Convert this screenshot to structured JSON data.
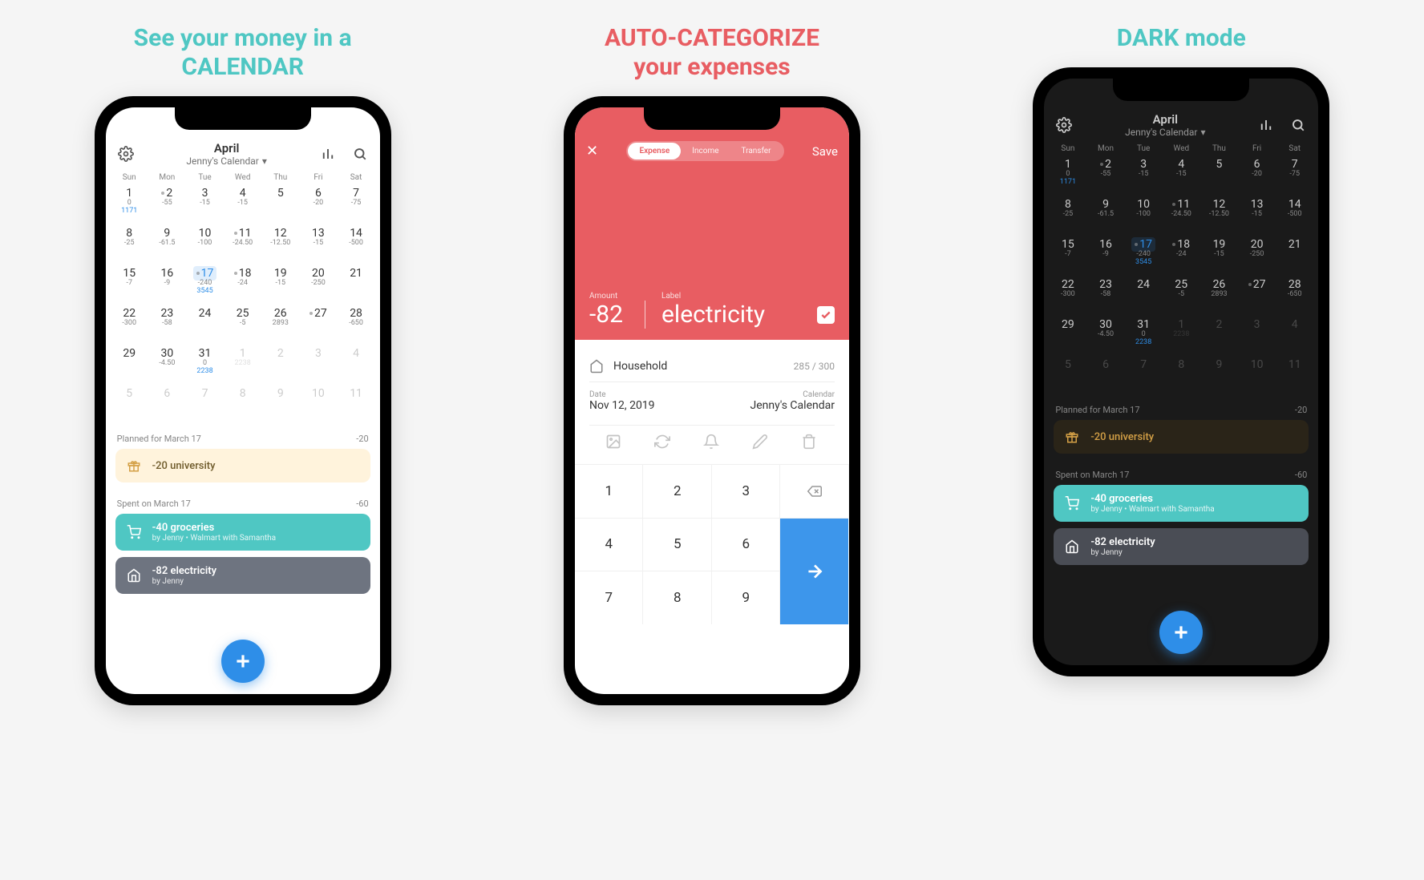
{
  "headlines": {
    "panel1_l1": "See your money in a",
    "panel1_l2": "CALENDAR",
    "panel2_l1": "AUTO-CATEGORIZE",
    "panel2_l2": "your expenses",
    "panel3": "DARK mode"
  },
  "calendar": {
    "month": "April",
    "subtitle": "Jenny's Calendar",
    "dow": [
      "Sun",
      "Mon",
      "Tue",
      "Wed",
      "Thu",
      "Fri",
      "Sat"
    ],
    "cells": [
      {
        "d": "1",
        "v1": "0",
        "v2": "1171"
      },
      {
        "d": "2",
        "v1": "-55",
        "dot": true
      },
      {
        "d": "3",
        "v1": "-15"
      },
      {
        "d": "4",
        "v1": "-15"
      },
      {
        "d": "5"
      },
      {
        "d": "6",
        "v1": "-20"
      },
      {
        "d": "7",
        "v1": "-75"
      },
      {
        "d": "8",
        "v1": "-25"
      },
      {
        "d": "9",
        "v1": "-61.5"
      },
      {
        "d": "10",
        "v1": "-100"
      },
      {
        "d": "11",
        "v1": "-24.50",
        "dot": true
      },
      {
        "d": "12",
        "v1": "-12.50"
      },
      {
        "d": "13",
        "v1": "-15"
      },
      {
        "d": "14",
        "v1": "-500"
      },
      {
        "d": "15",
        "v1": "-7"
      },
      {
        "d": "16",
        "v1": "-9"
      },
      {
        "d": "17",
        "v1": "-240",
        "v2": "3545",
        "dot": true,
        "today": true
      },
      {
        "d": "18",
        "v1": "-24",
        "dot": true
      },
      {
        "d": "19",
        "v1": "-15"
      },
      {
        "d": "20",
        "v1": "-250"
      },
      {
        "d": "21"
      },
      {
        "d": "22",
        "v1": "-300"
      },
      {
        "d": "23",
        "v1": "-58"
      },
      {
        "d": "24"
      },
      {
        "d": "25",
        "v1": "-5"
      },
      {
        "d": "26",
        "v1": "2893"
      },
      {
        "d": "27",
        "dot": true
      },
      {
        "d": "28",
        "v1": "-650"
      },
      {
        "d": "29"
      },
      {
        "d": "30",
        "v1": "-4.50"
      },
      {
        "d": "31",
        "v1": "0",
        "v2": "2238"
      },
      {
        "d": "1",
        "v1": "2238",
        "faded": true
      },
      {
        "d": "2",
        "faded": true
      },
      {
        "d": "3",
        "faded": true
      },
      {
        "d": "4",
        "faded": true
      },
      {
        "d": "5",
        "faded": true
      },
      {
        "d": "6",
        "faded": true
      },
      {
        "d": "7",
        "faded": true
      },
      {
        "d": "8",
        "faded": true
      },
      {
        "d": "9",
        "faded": true
      },
      {
        "d": "10",
        "faded": true
      },
      {
        "d": "11",
        "faded": true
      }
    ],
    "planned_head": "Planned for March 17",
    "planned_amount": "-20",
    "planned_item": "-20 university",
    "spent_head": "Spent on March 17",
    "spent_amount": "-60",
    "groceries_title": "-40 groceries",
    "groceries_sub": "by Jenny • Walmart with Samantha",
    "electricity_title": "-82 electricity",
    "electricity_sub": "by Jenny"
  },
  "expense": {
    "seg_expense": "Expense",
    "seg_income": "Income",
    "seg_transfer": "Transfer",
    "save": "Save",
    "amount_label": "Amount",
    "amount_value": "-82",
    "label_label": "Label",
    "label_value": "electricity",
    "category": "Household",
    "budget": "285 / 300",
    "date_label": "Date",
    "date_value": "Nov 12, 2019",
    "calendar_label": "Calendar",
    "calendar_value": "Jenny's Calendar",
    "keys": [
      "1",
      "2",
      "3",
      "4",
      "5",
      "6",
      "7",
      "8",
      "9"
    ]
  }
}
